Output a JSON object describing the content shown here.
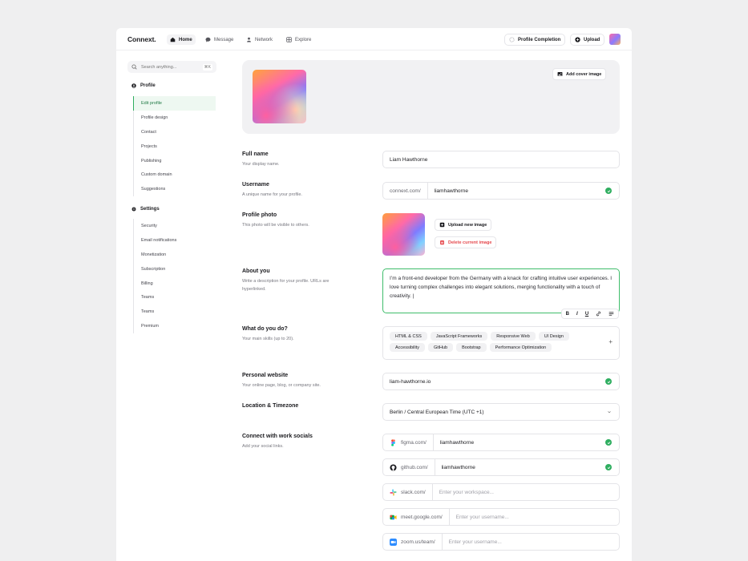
{
  "header": {
    "logo": "Connext.",
    "nav": [
      {
        "label": "Home",
        "icon": "home-icon"
      },
      {
        "label": "Message",
        "icon": "message-icon"
      },
      {
        "label": "Network",
        "icon": "network-icon"
      },
      {
        "label": "Explore",
        "icon": "explore-icon"
      }
    ],
    "profile_completion": "Profile Completion",
    "upload": "Upload"
  },
  "sidebar": {
    "search_placeholder": "Search anything...",
    "search_shortcut": "⌘K",
    "profile_heading": "Profile",
    "profile_items": [
      "Edit profile",
      "Profile design",
      "Contact",
      "Projects",
      "Publishing",
      "Custom domain",
      "Suggestions"
    ],
    "settings_heading": "Settings",
    "settings_items": [
      "Security",
      "Email notifications",
      "Monetization",
      "Subscription",
      "Billing",
      "Teams",
      "Teams",
      "Premium"
    ]
  },
  "cover": {
    "add_cover_label": "Add cover image"
  },
  "form": {
    "full_name": {
      "title": "Full name",
      "desc": "Your display name.",
      "value": "Liam Hawthorne"
    },
    "username": {
      "title": "Username",
      "desc": "A unique name for your profile.",
      "prefix": "connext.com/",
      "value": "liamhawthorne"
    },
    "photo": {
      "title": "Profile photo",
      "desc": "This photo will be visible to others.",
      "upload_label": "Upload new image",
      "delete_label": "Delete current image"
    },
    "about": {
      "title": "About you",
      "desc": "Write a description for your profile. URLs are hyperlinked.",
      "value": "I’m a front-end developer from the Germany with a knack for crafting intuitive user experiences. I love turning complex challenges into elegant solutions, merging functionality with a touch of creativity. |"
    },
    "skills": {
      "title": "What do you do?",
      "desc": "Your main skills (up to 20).",
      "items": [
        "HTML & CSS",
        "JavaScript Frameworks",
        "Responsive Web",
        "UI Design",
        "Accessibility",
        "GitHub",
        "Bootstrap",
        "Performance Optimization"
      ],
      "add": "+"
    },
    "website": {
      "title": "Personal website",
      "desc": "Your online page, blog, or company site.",
      "value": "liam-hawthorne.io"
    },
    "location": {
      "title": "Location & Timezone",
      "value": "Berlin / Central European Time (UTC +1)"
    },
    "socials": {
      "title": "Connect with work socials",
      "desc": "Add your social links.",
      "items": [
        {
          "prefix": "figma.com/",
          "value": "liamhawthorne",
          "placeholder": ""
        },
        {
          "prefix": "github.com/",
          "value": "liamhawthorne",
          "placeholder": ""
        },
        {
          "prefix": "slack.com/",
          "value": "",
          "placeholder": "Enter your workspace..."
        },
        {
          "prefix": "meet.google.com/",
          "value": "",
          "placeholder": "Enter your username..."
        },
        {
          "prefix": "zoom.us/team/",
          "value": "",
          "placeholder": "Enter your username..."
        }
      ]
    }
  },
  "toolbar": {
    "bold": "B",
    "italic": "I",
    "underline": "U"
  },
  "colors": {
    "accent": "#2fae60",
    "danger": "#e5484d"
  }
}
